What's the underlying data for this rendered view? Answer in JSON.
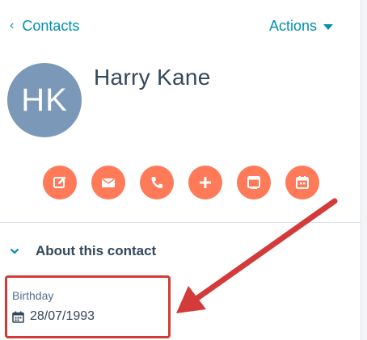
{
  "header": {
    "back_label": "Contacts",
    "actions_label": "Actions"
  },
  "contact": {
    "initials": "HK",
    "name": "Harry Kane"
  },
  "action_buttons": [
    {
      "icon": "edit-icon"
    },
    {
      "icon": "email-icon"
    },
    {
      "icon": "phone-icon"
    },
    {
      "icon": "plus-icon"
    },
    {
      "icon": "task-icon"
    },
    {
      "icon": "meeting-icon"
    }
  ],
  "about": {
    "title": "About this contact",
    "properties": [
      {
        "label": "Birthday",
        "value": "28/07/1993",
        "icon": "calendar-icon"
      }
    ]
  },
  "colors": {
    "accent": "#0091ae",
    "action_orange": "#ff7a59",
    "avatar": "#7b98b8",
    "annotation_red": "#d33a3a"
  }
}
